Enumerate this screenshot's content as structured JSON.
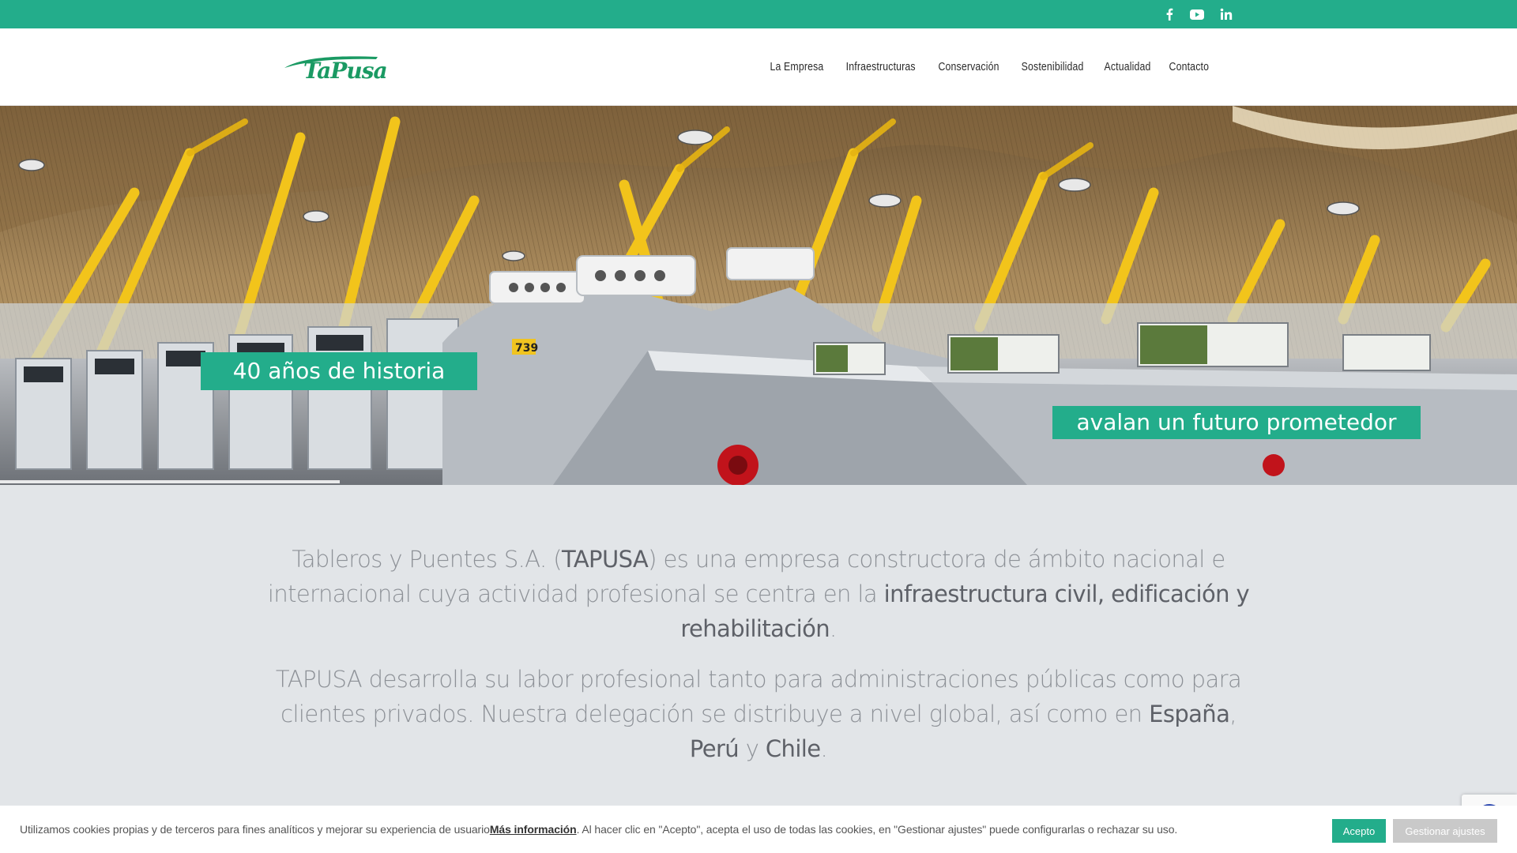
{
  "brand": {
    "logo_text": "TaPusa",
    "accent_color": "#23ad8b"
  },
  "topbar": {
    "social": [
      {
        "name": "facebook-icon"
      },
      {
        "name": "youtube-icon"
      },
      {
        "name": "linkedin-icon"
      }
    ]
  },
  "nav": {
    "items": [
      {
        "label": "La Empresa"
      },
      {
        "label": "Infraestructuras"
      },
      {
        "label": "Conservación"
      },
      {
        "label": "Sostenibilidad"
      },
      {
        "label": "Actualidad"
      },
      {
        "label": "Contacto"
      }
    ]
  },
  "hero": {
    "caption_left": "40 años de historia",
    "caption_right": "avalan un futuro prometedor",
    "gate_number": "739"
  },
  "intro": {
    "p1_a": "Tableros y Puentes S.A. (",
    "p1_b": "TAPUSA",
    "p1_c": ") es una empresa constructora de ámbito nacional e internacional cuya actividad profesional se centra en la ",
    "p1_d": "infraestructura civil, edificación y rehabilitación",
    "p1_e": ".",
    "p2_a": "TAPUSA desarrolla su labor profesional tanto para administraciones públicas como para clientes privados. Nuestra delegación se distribuye a nivel global, así como en ",
    "p2_b": "España",
    "p2_c": ", ",
    "p2_d": "Perú",
    "p2_e": " y ",
    "p2_f": "Chile",
    "p2_g": "."
  },
  "cookie": {
    "text_a": "Utilizamos cookies propias y de terceros para fines analíticos y mejorar su experiencia de usuario ",
    "link": "Más información",
    "text_b": ". Al hacer clic en \"Acepto\", acepta el uso de todas las cookies, en \"Gestionar ajustes\" puede configurarlas o rechazar su uso.",
    "accept": "Acepto",
    "manage": "Gestionar ajustes"
  }
}
